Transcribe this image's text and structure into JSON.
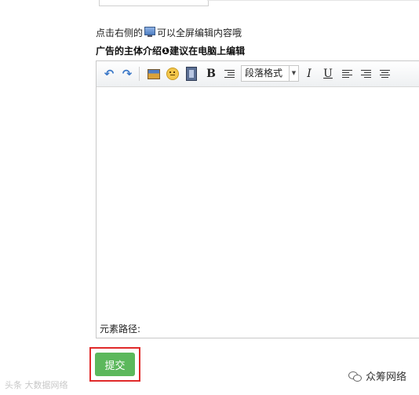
{
  "hint": {
    "before": "点击右侧的",
    "icon": "fullscreen-monitor-icon",
    "after": "可以全屏编辑内容哦"
  },
  "intro_label": "广告的主体介绍❶建议在电脑上编辑",
  "toolbar": {
    "icons": [
      "undo-icon",
      "redo-icon",
      "insert-image-icon",
      "emoji-icon",
      "insert-video-icon",
      "bold-icon",
      "indent-icon",
      "italic-icon",
      "underline-icon",
      "align-left-icon",
      "align-right-icon",
      "align-center-icon"
    ],
    "bold": "B",
    "italic": "I",
    "underline": "U",
    "paragraph_format": "段落格式"
  },
  "editor": {
    "content": "",
    "element_path_label": "元素路径:"
  },
  "submit_label": "提交",
  "watermark_left": "头条 大数据网络",
  "watermark_right": "众筹网络",
  "colors": {
    "submit_bg": "#5cb85c",
    "highlight_border": "#e02a2a",
    "icon_blue": "#3c79c8"
  }
}
